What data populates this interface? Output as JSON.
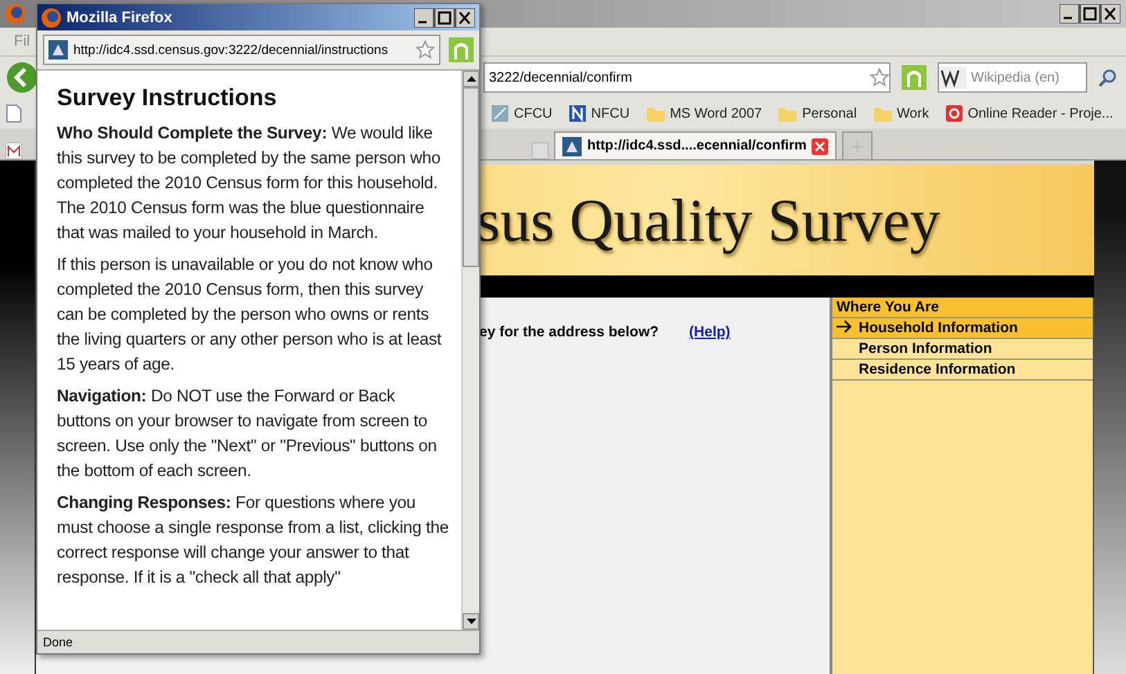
{
  "browser": {
    "menu_fragment": "Fil",
    "address": "3222/decennial/confirm",
    "search_placeholder": "Wikipedia (en)",
    "bookmarks": [
      {
        "label": "CFCU",
        "kind": "feed"
      },
      {
        "label": "NFCU",
        "kind": "letter"
      },
      {
        "label": "MS Word 2007",
        "kind": "folder"
      },
      {
        "label": "Personal",
        "kind": "folder"
      },
      {
        "label": "Work",
        "kind": "folder"
      },
      {
        "label": "Online Reader - Proje...",
        "kind": "reader"
      }
    ],
    "tabs": [
      {
        "label": "http://idc4.ssd....ecennial/confirm",
        "selected": true
      }
    ]
  },
  "page": {
    "banner_title": "sus Quality Survey",
    "question": "ey for the address below?",
    "help_link": "(Help)",
    "sidebar": {
      "heading": "Where You Are",
      "items": [
        {
          "label": "Household Information",
          "selected": true
        },
        {
          "label": "Person Information",
          "selected": false
        },
        {
          "label": "Residence Information",
          "selected": false
        }
      ]
    }
  },
  "popup": {
    "title": "Mozilla Firefox",
    "address": "http://idc4.ssd.census.gov:3222/decennial/instructions",
    "heading": "Survey Instructions",
    "status": "Done",
    "paragraphs": [
      "**Who Should Complete the Survey:** We would like this survey to be completed by the same person who completed the 2010 Census form for this household. The 2010 Census form was the blue questionnaire that was mailed to your household in March.",
      "If this person is unavailable or you do not know who completed the 2010 Census form, then this survey can be completed by the person who owns or rents the living quarters or any other person who is at least 15 years of age.",
      "**Navigation:** Do NOT use the Forward or Back buttons on your browser to navigate from screen to screen. Use only the \"Next\" or \"Previous\" buttons on the bottom of each screen.",
      "**Changing Responses:** For questions where you must choose a single response from a list, clicking the correct response will change your answer to that response. If it is a \"check all that apply\""
    ]
  }
}
